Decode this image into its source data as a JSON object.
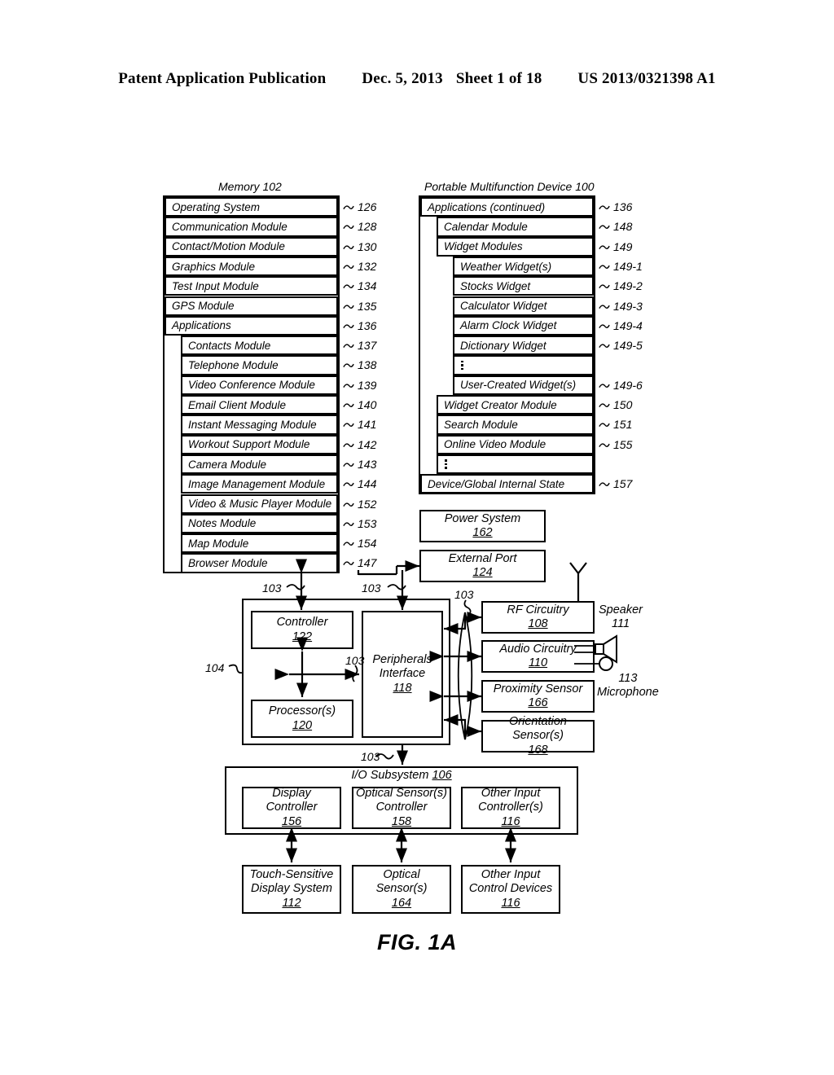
{
  "header": {
    "publication": "Patent Application Publication",
    "date": "Dec. 5, 2013",
    "sheet": "Sheet 1 of 18",
    "number": "US 2013/0321398 A1"
  },
  "figure_label": "FIG. 1A",
  "memory": {
    "title": "Memory 102",
    "items": [
      {
        "label": "Operating System",
        "ref": "126",
        "indent": 0
      },
      {
        "label": "Communication Module",
        "ref": "128",
        "indent": 0
      },
      {
        "label": "Contact/Motion Module",
        "ref": "130",
        "indent": 0
      },
      {
        "label": "Graphics Module",
        "ref": "132",
        "indent": 0
      },
      {
        "label": "Test Input Module",
        "ref": "134",
        "indent": 0
      },
      {
        "label": "GPS Module",
        "ref": "135",
        "indent": 0
      },
      {
        "label": "Applications",
        "ref": "136",
        "indent": 0
      },
      {
        "label": "Contacts Module",
        "ref": "137",
        "indent": 1
      },
      {
        "label": "Telephone Module",
        "ref": "138",
        "indent": 1
      },
      {
        "label": "Video Conference Module",
        "ref": "139",
        "indent": 1
      },
      {
        "label": "Email Client Module",
        "ref": "140",
        "indent": 1
      },
      {
        "label": "Instant Messaging Module",
        "ref": "141",
        "indent": 1
      },
      {
        "label": "Workout Support Module",
        "ref": "142",
        "indent": 1
      },
      {
        "label": "Camera Module",
        "ref": "143",
        "indent": 1
      },
      {
        "label": "Image Management Module",
        "ref": "144",
        "indent": 1
      },
      {
        "label": "Video & Music Player Module",
        "ref": "152",
        "indent": 1
      },
      {
        "label": "Notes Module",
        "ref": "153",
        "indent": 1
      },
      {
        "label": "Map Module",
        "ref": "154",
        "indent": 1
      },
      {
        "label": "Browser Module",
        "ref": "147",
        "indent": 1
      }
    ]
  },
  "device": {
    "title": "Portable Multifunction Device 100",
    "items": [
      {
        "label": "Applications (continued)",
        "ref": "136",
        "indent": 0
      },
      {
        "label": "Calendar Module",
        "ref": "148",
        "indent": 1
      },
      {
        "label": "Widget Modules",
        "ref": "149",
        "indent": 1
      },
      {
        "label": "Weather Widget(s)",
        "ref": "149-1",
        "indent": 2
      },
      {
        "label": "Stocks Widget",
        "ref": "149-2",
        "indent": 2
      },
      {
        "label": "Calculator Widget",
        "ref": "149-3",
        "indent": 2
      },
      {
        "label": "Alarm Clock Widget",
        "ref": "149-4",
        "indent": 2
      },
      {
        "label": "Dictionary Widget",
        "ref": "149-5",
        "indent": 2
      },
      {
        "label": "",
        "ref": "",
        "indent": 2,
        "ellipsis": true
      },
      {
        "label": "User-Created Widget(s)",
        "ref": "149-6",
        "indent": 2
      },
      {
        "label": "Widget Creator Module",
        "ref": "150",
        "indent": 1
      },
      {
        "label": "Search Module",
        "ref": "151",
        "indent": 1
      },
      {
        "label": "Online Video Module",
        "ref": "155",
        "indent": 1
      },
      {
        "label": "",
        "ref": "",
        "indent": 1,
        "ellipsis": true
      },
      {
        "label": "Device/Global Internal State",
        "ref": "157",
        "indent": 0
      }
    ]
  },
  "blocks": {
    "power_system": {
      "label": "Power System",
      "num": "162"
    },
    "external_port": {
      "label": "External Port",
      "num": "124"
    },
    "controller": {
      "label": "Controller",
      "num": "122"
    },
    "processor": {
      "label": "Processor(s)",
      "num": "120"
    },
    "peripherals_interface": {
      "label_line1": "Peripherals",
      "label_line2": "Interface",
      "num": "118"
    },
    "rf_circuitry": {
      "label": "RF Circuitry",
      "num": "108"
    },
    "audio_circuitry": {
      "label": "Audio Circuitry",
      "num": "110"
    },
    "proximity_sensor": {
      "label": "Proximity Sensor",
      "num": "166"
    },
    "orientation_sensor": {
      "label": "Orientation Sensor(s)",
      "num": "168"
    },
    "io_subsystem": {
      "label": "I/O Subsystem",
      "num": "106"
    },
    "display_controller": {
      "label_line1": "Display",
      "label_line2": "Controller",
      "num": "156"
    },
    "optical_sensor_controller": {
      "label_line1": "Optical Sensor(s)",
      "label_line2": "Controller",
      "num": "158"
    },
    "other_input_controller": {
      "label_line1": "Other Input",
      "label_line2": "Controller(s)",
      "num": "116"
    },
    "touch_display": {
      "label_line1": "Touch-Sensitive",
      "label_line2": "Display System",
      "num": "112"
    },
    "optical_sensor": {
      "label_line1": "Optical",
      "label_line2": "Sensor(s)",
      "num": "164"
    },
    "other_input_devices": {
      "label_line1": "Other Input",
      "label_line2": "Control Devices",
      "num": "116"
    }
  },
  "annotations": {
    "speaker": {
      "name": "Speaker",
      "num": "111"
    },
    "microphone": {
      "num": "113",
      "name": "Microphone"
    },
    "cpu_ref": "104",
    "bus_refs": [
      "103",
      "103",
      "103",
      "103",
      "103"
    ]
  }
}
